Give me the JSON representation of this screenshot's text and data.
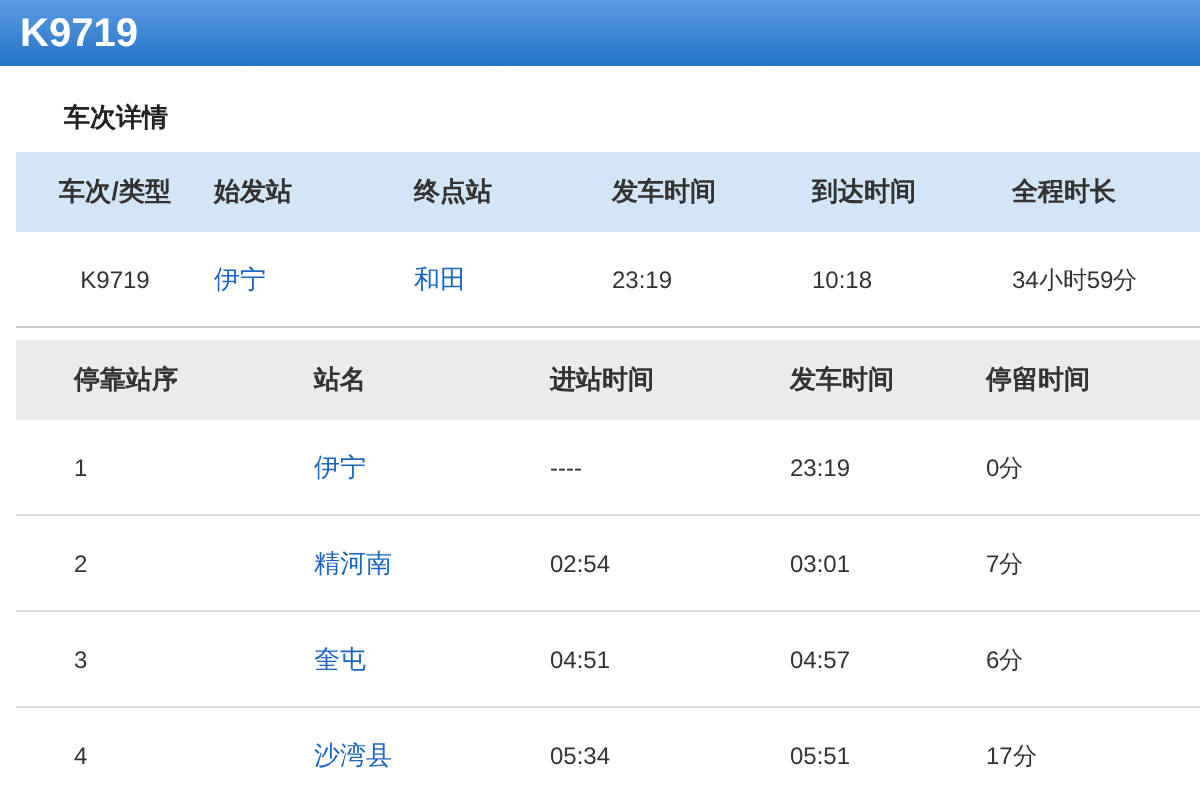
{
  "title": "K9719",
  "section_title": "车次详情",
  "summary": {
    "columns": [
      "车次/类型",
      "始发站",
      "终点站",
      "发车时间",
      "到达时间",
      "全程时长"
    ],
    "row": {
      "train": "K9719",
      "origin": "伊宁",
      "destination": "和田",
      "depart": "23:19",
      "arrive": "10:18",
      "duration": "34小时59分"
    }
  },
  "stops": {
    "columns": [
      "停靠站序",
      "站名",
      "进站时间",
      "发车时间",
      "停留时间"
    ],
    "rows": [
      {
        "seq": "1",
        "station": "伊宁",
        "arrive": "----",
        "depart": "23:19",
        "stay": "0分"
      },
      {
        "seq": "2",
        "station": "精河南",
        "arrive": "02:54",
        "depart": "03:01",
        "stay": "7分"
      },
      {
        "seq": "3",
        "station": "奎屯",
        "arrive": "04:51",
        "depart": "04:57",
        "stay": "6分"
      },
      {
        "seq": "4",
        "station": "沙湾县",
        "arrive": "05:34",
        "depart": "05:51",
        "stay": "17分"
      }
    ]
  }
}
